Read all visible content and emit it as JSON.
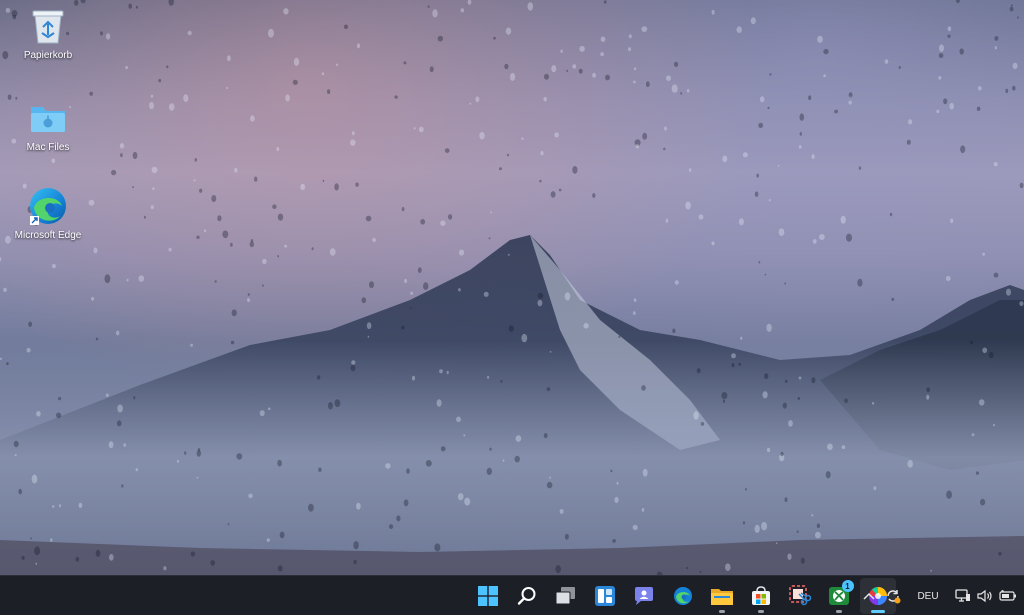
{
  "desktop": {
    "icons": [
      {
        "label": "Papierkorb",
        "icon": "recycle-bin-icon"
      },
      {
        "label": "Mac Files",
        "icon": "folder-icon"
      },
      {
        "label": "Microsoft Edge",
        "icon": "edge-icon"
      }
    ]
  },
  "taskbar": {
    "apps": [
      {
        "name": "start",
        "icon": "windows-logo-icon"
      },
      {
        "name": "search",
        "icon": "search-icon"
      },
      {
        "name": "task-view",
        "icon": "task-view-icon"
      },
      {
        "name": "widgets",
        "icon": "widgets-icon"
      },
      {
        "name": "chat",
        "icon": "teams-chat-icon"
      },
      {
        "name": "edge",
        "icon": "edge-icon"
      },
      {
        "name": "file-explorer",
        "icon": "folder-icon"
      },
      {
        "name": "store",
        "icon": "store-icon"
      },
      {
        "name": "snipping-tool",
        "icon": "snipping-tool-icon"
      },
      {
        "name": "xbox",
        "icon": "xbox-icon",
        "badge": "1"
      },
      {
        "name": "paint-app",
        "icon": "color-wheel-icon",
        "active": true
      }
    ],
    "tray": {
      "language": "DEU",
      "icons": [
        "chevron-up-icon",
        "sync-icon",
        "network-icon",
        "volume-icon",
        "battery-icon"
      ]
    }
  }
}
